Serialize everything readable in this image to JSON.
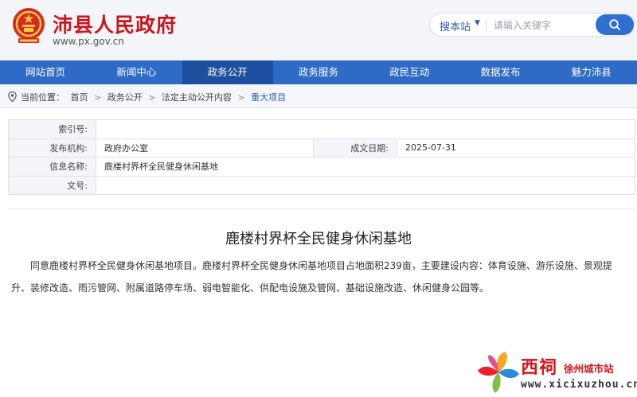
{
  "site": {
    "title": "沛县人民政府",
    "url": "www.px.gov.cn"
  },
  "search": {
    "scope_label": "搜本站",
    "placeholder": "请输入关键字"
  },
  "nav": {
    "items": [
      {
        "label": "网站首页"
      },
      {
        "label": "新闻中心"
      },
      {
        "label": "政务公开"
      },
      {
        "label": "政务服务"
      },
      {
        "label": "政民互动"
      },
      {
        "label": "数据发布"
      },
      {
        "label": "魅力沛县"
      }
    ],
    "active_index": 2
  },
  "breadcrumb": {
    "prefix": "当前位置：",
    "items": [
      "首页",
      "政务公开",
      "法定主动公开内容",
      "重大项目"
    ],
    "separator": ">"
  },
  "info": {
    "index_label": "索引号:",
    "index_value": "",
    "publisher_label": "发布机构:",
    "publisher_value": "政府办公室",
    "date_label": "成文日期:",
    "date_value": "2025-07-31",
    "name_label": "信息名称:",
    "name_value": "鹿楼村界杯全民健身休闲基地",
    "docno_label": "文号:",
    "docno_value": ""
  },
  "article": {
    "title": "鹿楼村界杯全民健身休闲基地",
    "body": "同意鹿楼村界杯全民健身休闲基地项目。鹿楼村界杯全民健身休闲基地项目占地面积239亩，主要建设内容：体育设施、游乐设施、景观提升、装修改造、雨污管网、附属道路停车场、弱电智能化、供配电设施及管网、基础设施改造、休闲健身公园等。"
  },
  "watermark": {
    "brand": "西祠",
    "tagline": "徐州城市站",
    "url": "www.xicixuzhou.cn"
  },
  "colors": {
    "brand_red": "#c8161e",
    "nav_blue": "#2e6bc6",
    "nav_active": "#1c4fa0",
    "link_blue": "#2a5db0"
  }
}
